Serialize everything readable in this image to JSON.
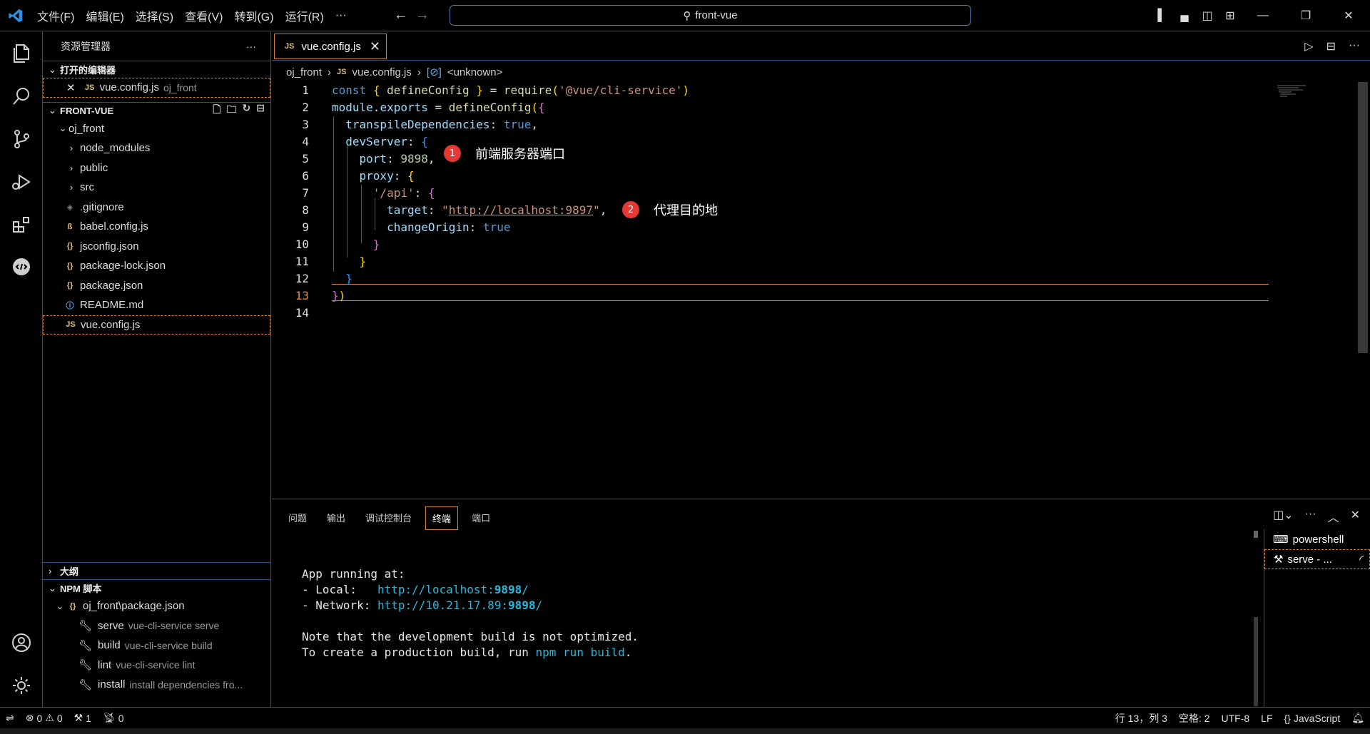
{
  "titlebar": {
    "menu": [
      "文件(F)",
      "编辑(E)",
      "选择(S)",
      "查看(V)",
      "转到(G)",
      "运行(R)",
      "···"
    ],
    "search_text": "front-vue"
  },
  "sidebar": {
    "title": "资源管理器",
    "open_editors_header": "打开的编辑器",
    "open_editor": {
      "name": "vue.config.js",
      "folder": "oj_front"
    },
    "root_header": "FRONT-VUE",
    "folder": "oj_front",
    "items": [
      {
        "label": "node_modules",
        "icon": "chevron-right"
      },
      {
        "label": "public",
        "icon": "chevron-right"
      },
      {
        "label": "src",
        "icon": "chevron-right"
      },
      {
        "label": ".gitignore",
        "icon": "git-icon"
      },
      {
        "label": "babel.config.js",
        "icon": "babel-icon"
      },
      {
        "label": "jsconfig.json",
        "icon": "json-icon"
      },
      {
        "label": "package-lock.json",
        "icon": "json-icon"
      },
      {
        "label": "package.json",
        "icon": "json-icon"
      },
      {
        "label": "README.md",
        "icon": "info-icon"
      },
      {
        "label": "vue.config.js",
        "icon": "js-icon"
      }
    ],
    "outline_header": "大纲",
    "npm_header": "NPM 脚本",
    "npm_package": "oj_front\\package.json",
    "npm_scripts": [
      {
        "name": "serve",
        "cmd": "vue-cli-service serve"
      },
      {
        "name": "build",
        "cmd": "vue-cli-service build"
      },
      {
        "name": "lint",
        "cmd": "vue-cli-service lint"
      },
      {
        "name": "install",
        "cmd": "install dependencies fro..."
      }
    ]
  },
  "editor": {
    "tab": "vue.config.js",
    "breadcrumb": [
      "oj_front",
      "vue.config.js",
      "<unknown>"
    ],
    "line_numbers": [
      "1",
      "2",
      "3",
      "4",
      "5",
      "6",
      "7",
      "8",
      "9",
      "10",
      "11",
      "12",
      "13",
      "14"
    ],
    "annotations": [
      {
        "badge": "1",
        "text": "前端服务器端口"
      },
      {
        "badge": "2",
        "text": "代理目的地"
      }
    ]
  },
  "panel": {
    "tabs": [
      "问题",
      "输出",
      "调试控制台",
      "终端",
      "端口"
    ],
    "active_tab": "终端",
    "terminal": {
      "line1": "App running at:",
      "local_label": "- Local:   ",
      "local_url_a": "http://localhost:",
      "local_port": "9898",
      "local_url_b": "/",
      "network_label": "- Network: ",
      "network_url_a": "http://10.21.17.89:",
      "network_port": "9898",
      "network_url_b": "/",
      "note1": "Note that the development build is not optimized.",
      "note2_a": "To create a production build, run ",
      "note2_cmd": "npm run build",
      "note2_b": "."
    },
    "terminals": [
      "powershell",
      "serve - ..."
    ]
  },
  "statusbar": {
    "errors": "0",
    "warnings": "0",
    "tools": "1",
    "ports": "0",
    "position": "行 13，列 3",
    "spaces": "空格: 2",
    "encoding": "UTF-8",
    "eol": "LF",
    "language": "JavaScript"
  },
  "colors": {
    "accent_border": "#d9822b",
    "divider": "#1e5a86",
    "badge": "#e53935"
  }
}
